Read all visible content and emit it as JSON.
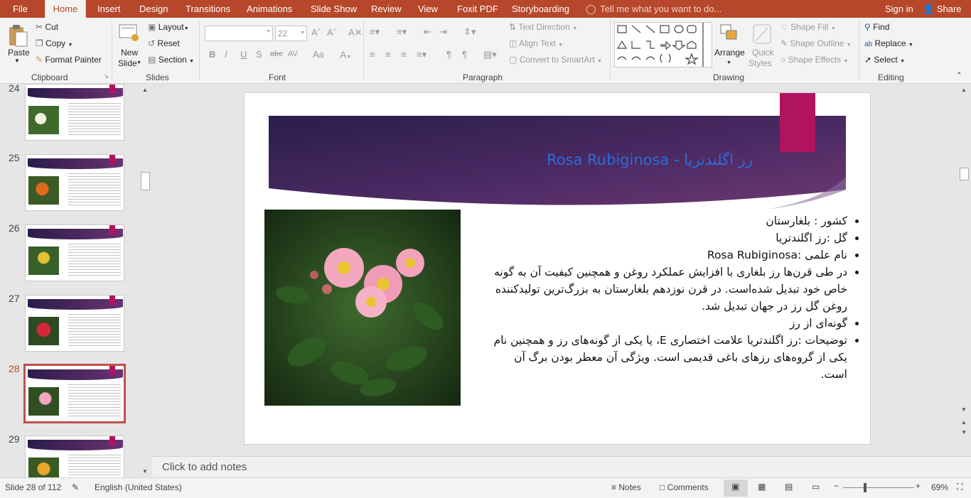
{
  "menubar": {
    "tabs": [
      "File",
      "Home",
      "Insert",
      "Design",
      "Transitions",
      "Animations",
      "Slide Show",
      "Review",
      "View",
      "Foxit PDF",
      "Storyboarding"
    ],
    "active_tab": "Home",
    "tell_me": "Tell me what you want to do...",
    "sign_in": "Sign in",
    "share": "Share"
  },
  "ribbon": {
    "clipboard": {
      "paste": "Paste",
      "cut": "Cut",
      "copy": "Copy",
      "format_painter": "Format Painter",
      "label": "Clipboard"
    },
    "slides": {
      "new_slide": "New",
      "new_slide2": "Slide",
      "layout": "Layout",
      "reset": "Reset",
      "section": "Section",
      "label": "Slides"
    },
    "font": {
      "font_name": "",
      "font_size": "22",
      "bold": "B",
      "italic": "I",
      "underline": "U",
      "shadow": "S",
      "strike": "abc",
      "spacing": "AV",
      "case": "Aa",
      "label": "Font"
    },
    "paragraph": {
      "text_direction": "Text Direction",
      "align_text": "Align Text",
      "convert_smartart": "Convert to SmartArt",
      "label": "Paragraph"
    },
    "drawing": {
      "arrange": "Arrange",
      "quick_styles": "Quick",
      "quick_styles2": "Styles",
      "shape_fill": "Shape Fill",
      "shape_outline": "Shape Outline",
      "shape_effects": "Shape Effects",
      "label": "Drawing"
    },
    "editing": {
      "find": "Find",
      "replace": "Replace",
      "select": "Select",
      "label": "Editing"
    }
  },
  "thumbnails": [
    {
      "number": "24",
      "flower": "#f2f2e0",
      "selected": false
    },
    {
      "number": "25",
      "flower": "#e06a1e",
      "selected": false
    },
    {
      "number": "26",
      "flower": "#e2c433",
      "selected": false
    },
    {
      "number": "27",
      "flower": "#d6283a",
      "selected": false
    },
    {
      "number": "28",
      "flower": "#f2a6bf",
      "selected": true
    },
    {
      "number": "29",
      "flower": "#e8a62a",
      "selected": false
    }
  ],
  "slide": {
    "title": "Rosa Rubiginosa - رز اگلندتریا",
    "bullets": [
      "کشور : بلغارستان",
      "گل :رز اگلندتریا",
      "نام علمی :Rosa Rubiginosa",
      "در طی قرن‌ها رز بلغاری با افزایش عملکرد روغن و همچنین کیفیت آن به گونه خاص خود تبدیل شده‌است. در قرن نوزدهم بلغارستان به بزرگ‌ترین تولیدکننده روغن گل رز در جهان تبدیل شد.",
      "گونه‌ای از رز",
      "توضیحات :رز اگلندتریا علامت اختصاری E، یا یکی از گونه‌های رز و همچنین نام یکی از گروه‌های رزهای باغی قدیمی است. ویژگی آن معطر بودن برگ آن است."
    ]
  },
  "notes": {
    "placeholder": "Click to add notes"
  },
  "status": {
    "slide_counter": "Slide 28 of 112",
    "language": "English (United States)",
    "notes_button": "Notes",
    "comments_button": "Comments",
    "zoom": "69%"
  },
  "colors": {
    "accent": "#b7472a",
    "title_band": "#3a2358",
    "pink_bar": "#b1145f",
    "title_text": "#2e6bd6"
  }
}
